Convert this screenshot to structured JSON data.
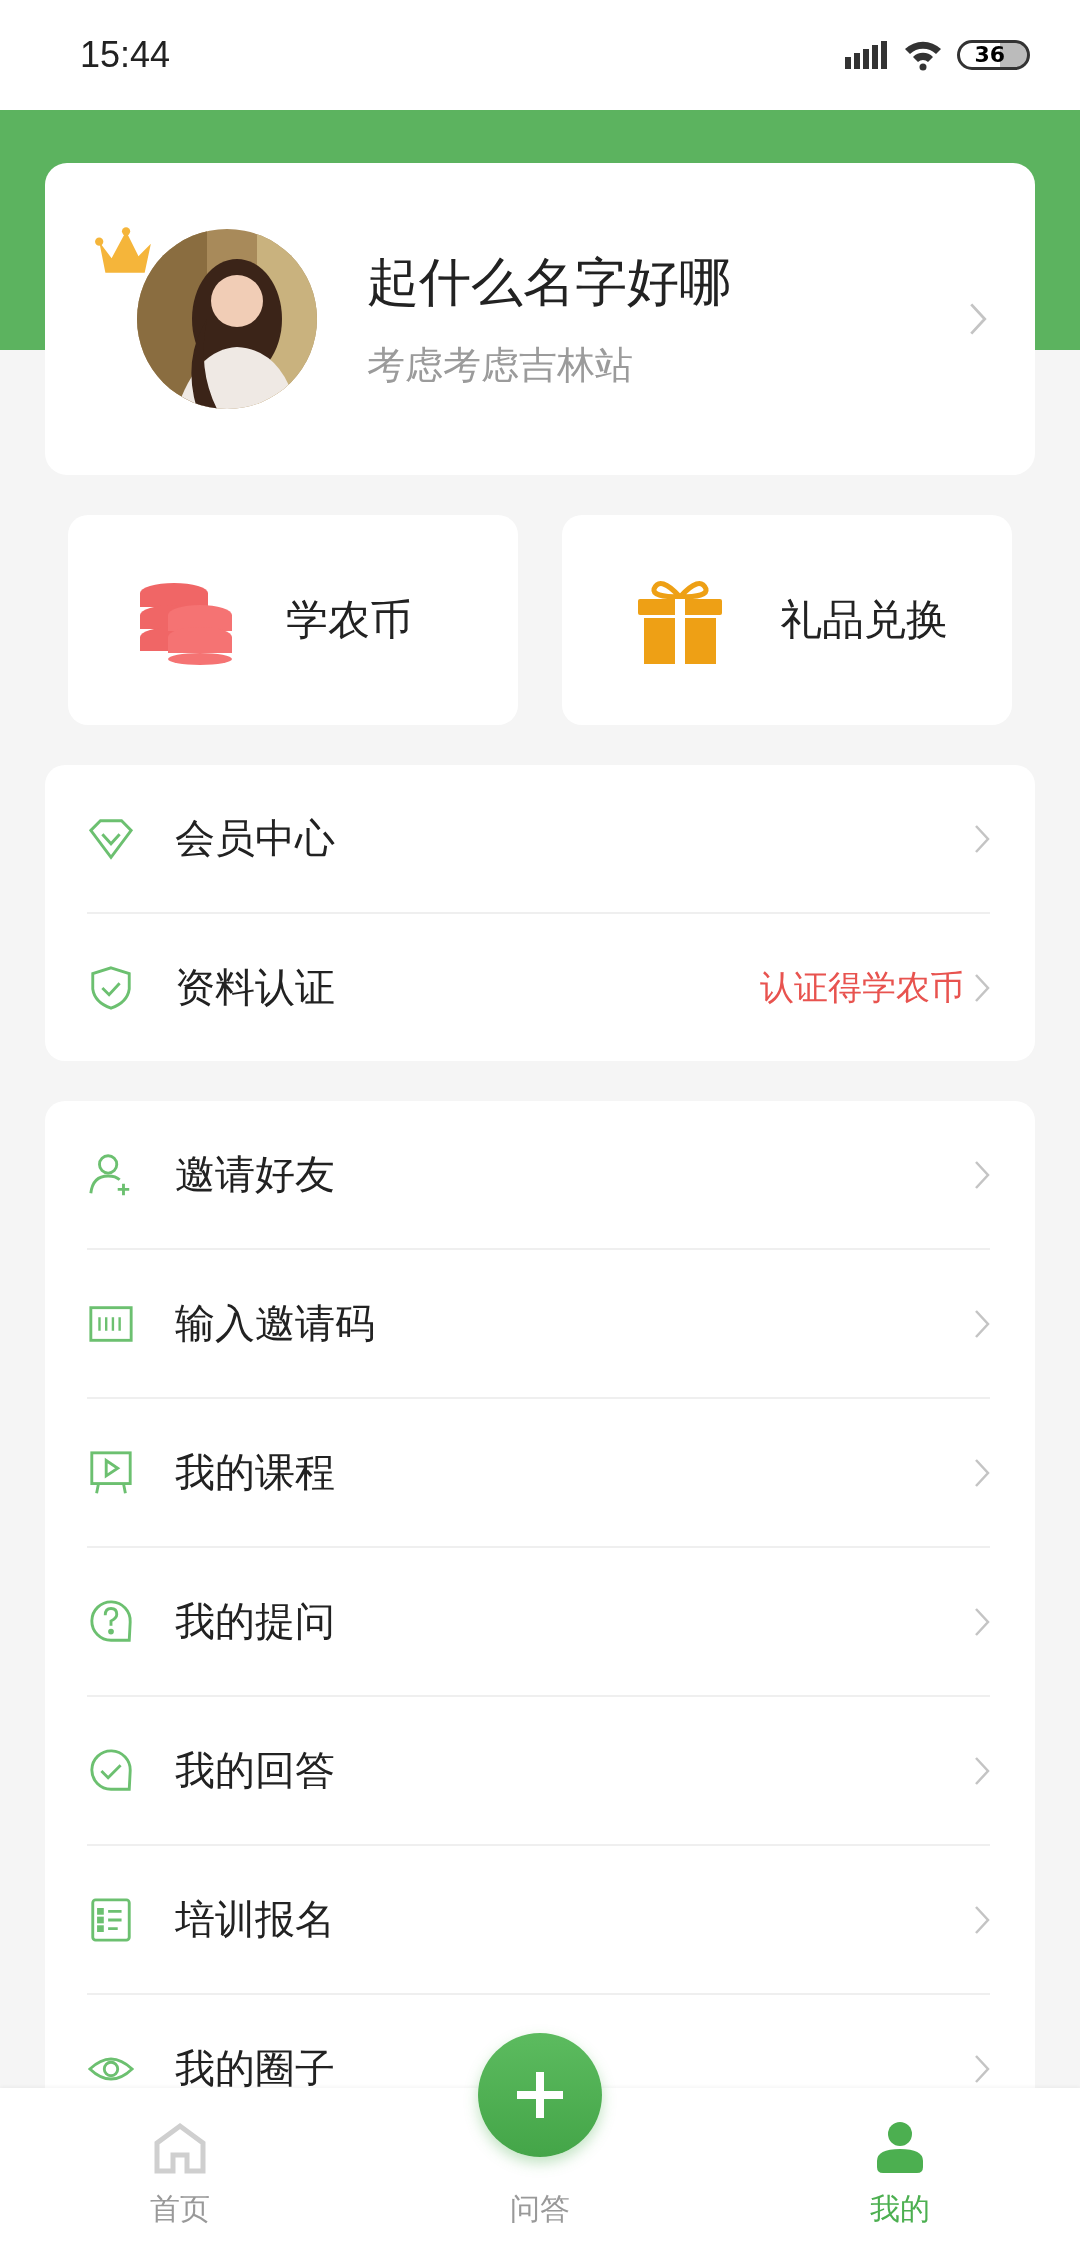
{
  "status_bar": {
    "time": "15:44",
    "battery": "36"
  },
  "profile": {
    "name": "起什么名字好哪",
    "subtitle": "考虑考虑吉林站",
    "crowned": true
  },
  "quick_actions": [
    {
      "kind": "coins",
      "label": "学农币"
    },
    {
      "kind": "gift",
      "label": "礼品兑换"
    }
  ],
  "groups": [
    [
      {
        "kind": "diamond",
        "label": "会员中心"
      },
      {
        "kind": "shield",
        "label": "资料认证",
        "note": "认证得学农币"
      }
    ],
    [
      {
        "kind": "invite",
        "label": "邀请好友"
      },
      {
        "kind": "code",
        "label": "输入邀请码"
      },
      {
        "kind": "course",
        "label": "我的课程"
      },
      {
        "kind": "question",
        "label": "我的提问"
      },
      {
        "kind": "answer",
        "label": "我的回答"
      },
      {
        "kind": "list",
        "label": "培训报名"
      },
      {
        "kind": "circle",
        "label": "我的圈子"
      }
    ]
  ],
  "tab_bar": [
    {
      "kind": "home",
      "label": "首页",
      "selected": false
    },
    {
      "kind": "add",
      "label": "问答",
      "selected": false
    },
    {
      "kind": "me",
      "label": "我的",
      "selected": true
    }
  ]
}
